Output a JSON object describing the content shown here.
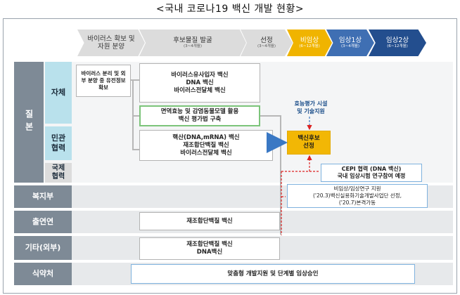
{
  "title": "<국내 코로나19 백신 개발 현황>",
  "phases": [
    {
      "label": "바이러스 확보 및 자원 분양",
      "sub": ""
    },
    {
      "label": "후보물질 발굴",
      "sub": "(3~4개월)"
    },
    {
      "label": "선정",
      "sub": "(3~4개월)"
    },
    {
      "label": "비임상",
      "sub": "(6~12개월)"
    },
    {
      "label": "임상1상",
      "sub": "(3~4개월)"
    },
    {
      "label": "임상2상",
      "sub": "(6~12개월)"
    }
  ],
  "rows": {
    "gov_group": "질본",
    "own": "자체",
    "public_private": "민관 협력",
    "intl": "국제 협력",
    "welfare": "복지부",
    "science": "출연연",
    "others": "기타(외부)",
    "mfds": "식약처"
  },
  "boxes": {
    "isolation": "바이러스 분리 및 외부 분양 중 유전정보 확보",
    "own_candidates": "바이러스유사입자 백신\nDNA 백신\n바이러스전달체 백신",
    "eval_method": "면역효능 및 감염동물모델 활용\n백신 평가법 구축",
    "pp_candidates": "핵산(DNA,mRNA) 백신\n재조합단백질 백신\n바이러스전달체 백신",
    "selection": "백신후보\n선정",
    "cepi": "CEPI 협력 (DNA 백신)\n국내 임상시험 연구참여 예정",
    "welfare_support": "비임상/임상연구 지원\n('20.3)백신실용화기술개발사업단 선정,\n('20.7)본격가동",
    "science_vaccine": "재조합단백질 백신",
    "others_vaccine": "재조합단백질 백신\nDNA백신",
    "mfds_support": "맞춤형 개발지원 및 단계별 임상승인"
  },
  "notes": {
    "efficacy": "효능평가 시설\n및 기술지원"
  }
}
